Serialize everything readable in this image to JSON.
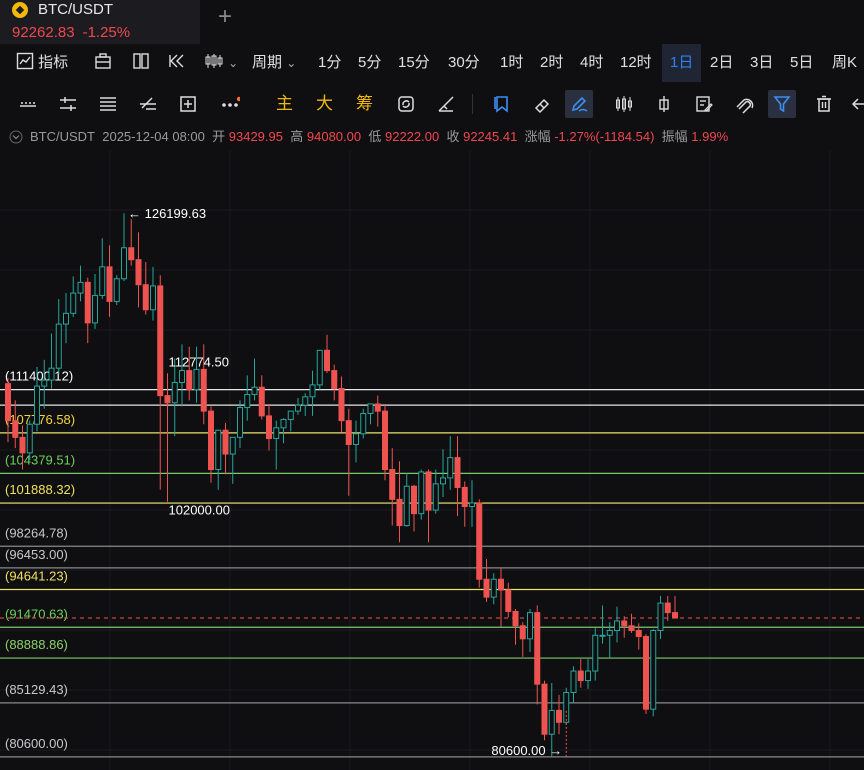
{
  "tab": {
    "title": "BTC/USDT",
    "price": "92262.83",
    "change": "-1.25%",
    "add_icon": "plus-icon"
  },
  "toolbar1": {
    "indicators": "指标",
    "period": "周期",
    "intervals": [
      "1分",
      "5分",
      "15分",
      "30分",
      "1时",
      "2时",
      "4时",
      "12时",
      "1日",
      "2日",
      "3日",
      "5日",
      "周K"
    ],
    "active_interval": "1日"
  },
  "toolbar2": {
    "main": "主",
    "big": "大",
    "chips": "筹"
  },
  "info": {
    "symbol": "BTC/USDT",
    "datetime": "2025-12-04 08:00",
    "open_label": "开",
    "open": "93429.95",
    "high_label": "高",
    "high": "94080.00",
    "low_label": "低",
    "low": "92222.00",
    "close_label": "收",
    "close": "92245.41",
    "chg_label": "涨幅",
    "chg": "-1.27%(-1184.54)",
    "amp_label": "振幅",
    "amp": "1.99%"
  },
  "chart_data": {
    "type": "candlestick",
    "price_range": [
      79500,
      131500
    ],
    "up_color": "#26a69a",
    "down_color": "#ef5350",
    "candles": [
      [
        111900,
        112400,
        107000,
        108800
      ],
      [
        108800,
        110500,
        106500,
        107400
      ],
      [
        107400,
        108400,
        104700,
        106100
      ],
      [
        106100,
        108800,
        105500,
        108500
      ],
      [
        108500,
        113300,
        107900,
        111700
      ],
      [
        111700,
        113900,
        109800,
        112200
      ],
      [
        112200,
        116100,
        111500,
        113200
      ],
      [
        113200,
        119000,
        112700,
        116900
      ],
      [
        116900,
        119500,
        115300,
        117800
      ],
      [
        117800,
        120900,
        117500,
        119500
      ],
      [
        119500,
        121800,
        118800,
        120400
      ],
      [
        120400,
        120800,
        115300,
        117000
      ],
      [
        117000,
        121100,
        116500,
        119300
      ],
      [
        119300,
        124100,
        119000,
        121700
      ],
      [
        121700,
        123500,
        117500,
        118800
      ],
      [
        118800,
        121000,
        118500,
        120700
      ],
      [
        120700,
        126199.63,
        120500,
        123300
      ],
      [
        123300,
        125700,
        121800,
        122300
      ],
      [
        122300,
        124600,
        118300,
        120200
      ],
      [
        120200,
        122100,
        117700,
        118100
      ],
      [
        118100,
        121700,
        117200,
        120100
      ],
      [
        120100,
        121000,
        103000,
        110900
      ],
      [
        110900,
        112774.5,
        102000,
        110300
      ],
      [
        110300,
        114000,
        107500,
        112000
      ],
      [
        112000,
        115200,
        110000,
        113000
      ],
      [
        113000,
        115000,
        110500,
        111400
      ],
      [
        111400,
        115000,
        110300,
        113100
      ],
      [
        113100,
        115200,
        108500,
        109600
      ],
      [
        109600,
        110000,
        103600,
        104700
      ],
      [
        104700,
        107500,
        103000,
        108000
      ],
      [
        108000,
        108600,
        104300,
        106000
      ],
      [
        106000,
        107200,
        103500,
        107400
      ],
      [
        107400,
        110500,
        106500,
        109900
      ],
      [
        109900,
        112600,
        108800,
        111000
      ],
      [
        111000,
        114000,
        110500,
        111600
      ],
      [
        111600,
        112600,
        108900,
        109200
      ],
      [
        109200,
        110200,
        106300,
        107300
      ],
      [
        107300,
        108800,
        104700,
        108200
      ],
      [
        108200,
        109000,
        106900,
        108900
      ],
      [
        108900,
        109600,
        107900,
        109600
      ],
      [
        109600,
        110700,
        109300,
        110100
      ],
      [
        110100,
        111100,
        109200,
        110800
      ],
      [
        110800,
        113000,
        109200,
        111800
      ],
      [
        111800,
        114700,
        111400,
        114700
      ],
      [
        114700,
        116000,
        112800,
        113000
      ],
      [
        113000,
        113500,
        110500,
        111500
      ],
      [
        111500,
        112500,
        107800,
        108800
      ],
      [
        108800,
        109800,
        102500,
        106800
      ],
      [
        106800,
        108800,
        105300,
        107700
      ],
      [
        107700,
        109800,
        107300,
        109400
      ],
      [
        109400,
        110200,
        108500,
        110200
      ],
      [
        110200,
        110900,
        108300,
        109600
      ],
      [
        109600,
        110200,
        103800,
        104700
      ],
      [
        104700,
        106500,
        100000,
        102200
      ],
      [
        102200,
        105400,
        98600,
        100000
      ],
      [
        100000,
        104400,
        99900,
        103300
      ],
      [
        103300,
        103400,
        99500,
        101000
      ],
      [
        101000,
        104700,
        100500,
        104500
      ],
      [
        104500,
        104700,
        98600,
        101300
      ],
      [
        101300,
        104700,
        101000,
        103500
      ],
      [
        103500,
        106400,
        102400,
        104000
      ],
      [
        104000,
        107500,
        103000,
        105700
      ],
      [
        105700,
        107500,
        100800,
        103200
      ],
      [
        103200,
        103700,
        99900,
        101600
      ],
      [
        101600,
        103800,
        99900,
        101900
      ],
      [
        101900,
        102200,
        94800,
        95500
      ],
      [
        95500,
        97200,
        93600,
        94000
      ],
      [
        94000,
        96000,
        93400,
        95500
      ],
      [
        95500,
        96500,
        91500,
        94600
      ],
      [
        94600,
        95200,
        92300,
        92800
      ],
      [
        92800,
        93000,
        90000,
        91600
      ],
      [
        91600,
        91900,
        89000,
        90500
      ],
      [
        90500,
        93000,
        89400,
        92700
      ],
      [
        92700,
        93300,
        85000,
        86700
      ],
      [
        86700,
        87000,
        82000,
        82500
      ],
      [
        82500,
        86800,
        80600,
        84500
      ],
      [
        84500,
        85800,
        82500,
        83500
      ],
      [
        83500,
        86400,
        83300,
        86000
      ],
      [
        86000,
        88200,
        85100,
        87800
      ],
      [
        87800,
        88800,
        86400,
        87000
      ],
      [
        87000,
        88800,
        86300,
        87800
      ],
      [
        87800,
        91400,
        87000,
        90800
      ],
      [
        90800,
        93300,
        90100,
        90800
      ],
      [
        90800,
        91900,
        88900,
        91200
      ],
      [
        91200,
        93200,
        90200,
        92000
      ],
      [
        92000,
        92400,
        90600,
        91600
      ],
      [
        91600,
        92600,
        91000,
        91200
      ],
      [
        91200,
        91800,
        89600,
        90700
      ],
      [
        90700,
        90900,
        84200,
        84600
      ],
      [
        84600,
        91300,
        84000,
        91200
      ],
      [
        91200,
        94100,
        90500,
        93500
      ],
      [
        93500,
        94100,
        92000,
        92700
      ],
      [
        92700,
        94080,
        92222,
        92245.41
      ]
    ],
    "levels": [
      {
        "label": "(111400.12)",
        "price": 111400.12,
        "color": "#e6e6e6",
        "label_color": "#ffffff"
      },
      {
        "label": "",
        "price": 110100,
        "color": "#e6e6e6",
        "label_color": "#ffffff"
      },
      {
        "label": "(107776.58)",
        "price": 107776.58,
        "color": "#e8e26a",
        "label_color": "#f0d53c"
      },
      {
        "label": "(104379.51)",
        "price": 104379.51,
        "color": "#7cc86f",
        "label_color": "#6fcf5a"
      },
      {
        "label": "(101888.32)",
        "price": 101888.32,
        "color": "#f3ec7a",
        "label_color": "#f0e060"
      },
      {
        "label": "(98264.78)",
        "price": 98264.78,
        "color": "#8a8a8a",
        "label_color": "#c8c8c8"
      },
      {
        "label": "(96453.00)",
        "price": 96453.0,
        "color": "#8a8a8a",
        "label_color": "#c8c8c8"
      },
      {
        "label": "(94641.23)",
        "price": 94641.23,
        "color": "#e8e26a",
        "label_color": "#f0e060"
      },
      {
        "label": "(91470.63)",
        "price": 91470.63,
        "color": "#7cc86f",
        "label_color": "#6fcf5a"
      },
      {
        "label": "(88888.86)",
        "price": 88888.86,
        "color": "#7cc86f",
        "label_color": "#8ed06a"
      },
      {
        "label": "(85129.43)",
        "price": 85129.43,
        "color": "#8a8a8a",
        "label_color": "#c8c8c8"
      },
      {
        "label": "(80600.00)",
        "price": 80600.0,
        "color": "#8a8a8a",
        "label_color": "#c8c8c8"
      }
    ],
    "current_price": 92245.41,
    "annotations": [
      {
        "text": "← 126199.63",
        "price": 126199.63,
        "candle": 16,
        "side": "right"
      },
      {
        "text": "112774.50",
        "price": 112774.5,
        "candle": 22,
        "side": "above"
      },
      {
        "text": "102000.00",
        "price": 102000.0,
        "candle": 22,
        "side": "below"
      },
      {
        "text": "80600.00 →",
        "price": 80600.0,
        "candle": 77,
        "side": "left"
      }
    ]
  }
}
